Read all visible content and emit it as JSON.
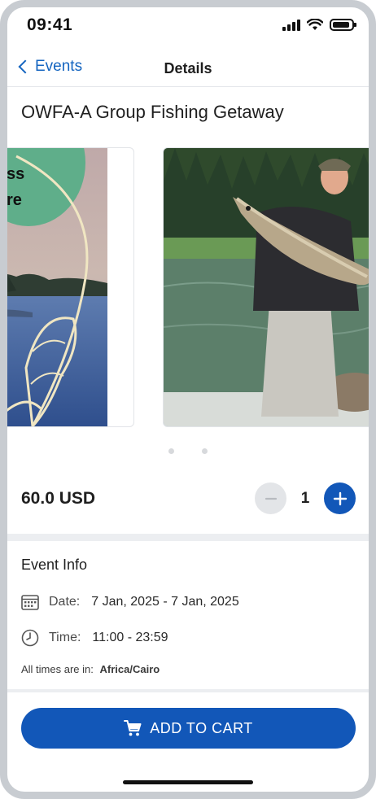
{
  "status_bar": {
    "time": "09:41"
  },
  "nav": {
    "back_label": "Events",
    "title": "Details"
  },
  "event": {
    "title": "OWFA-A Group Fishing Getaway"
  },
  "carousel": {
    "slide_count": 2,
    "slide_1_poster_text": [
      "ss",
      "re"
    ]
  },
  "purchase": {
    "price": "60.0 USD",
    "quantity": "1"
  },
  "event_info": {
    "heading": "Event Info",
    "date_label": "Date:",
    "date_value": "7 Jan, 2025 - 7 Jan, 2025",
    "time_label": "Time:",
    "time_value": "11:00 - 23:59",
    "timezone_label": "All times are in:",
    "timezone_value": "Africa/Cairo"
  },
  "cart": {
    "button_label": "ADD TO CART"
  },
  "colors": {
    "accent": "#1257b8",
    "link": "#1565c0",
    "divider": "#eceef1"
  },
  "icons": [
    "signal-icon",
    "wifi-icon",
    "battery-icon",
    "back-chevron-icon",
    "minus-icon",
    "plus-icon",
    "calendar-icon",
    "clock-icon",
    "cart-icon"
  ]
}
